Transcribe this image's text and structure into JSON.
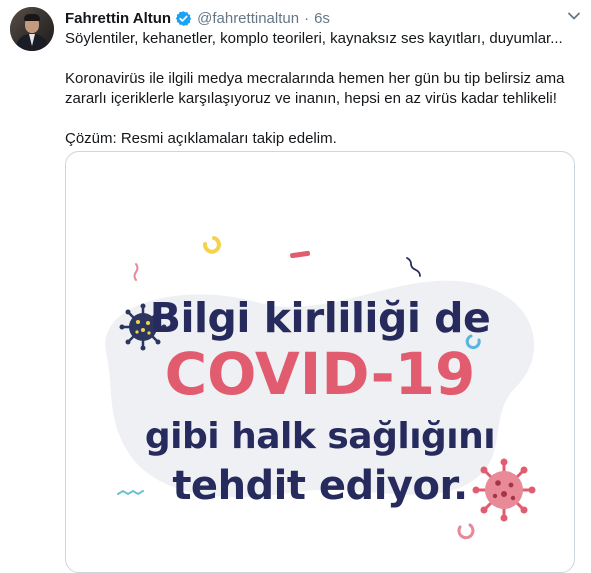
{
  "tweet": {
    "author_name": "Fahrettin Altun",
    "handle": "@fahrettinaltun",
    "separator": "·",
    "timestamp": "6s",
    "lines": [
      "Söylentiler, kehanetler, komplo teorileri, kaynaksız ses kayıtları, duyumlar...",
      "Koronavirüs ile ilgili medya mecralarında hemen her gün bu tip belirsiz ama",
      "zararlı içeriklerle karşılaşıyoruz ve inanın, hepsi en az virüs kadar tehlikeli!",
      "Çözüm: Resmi açıklamaları takip edelim."
    ]
  },
  "media_card": {
    "headline_line1": "Bilgi kirliliği de",
    "headline_line2": "COVID-19",
    "headline_line3": "gibi halk sağlığını",
    "headline_line4": "tehdit ediyor.",
    "colors": {
      "navy": "#262a5c",
      "pink": "#e25c70",
      "blob": "#eef0f3"
    }
  },
  "icons": {
    "verified": "verified-badge-icon",
    "menu": "chevron-down-icon",
    "virus_left": "virus-icon",
    "virus_right": "virus-icon"
  }
}
